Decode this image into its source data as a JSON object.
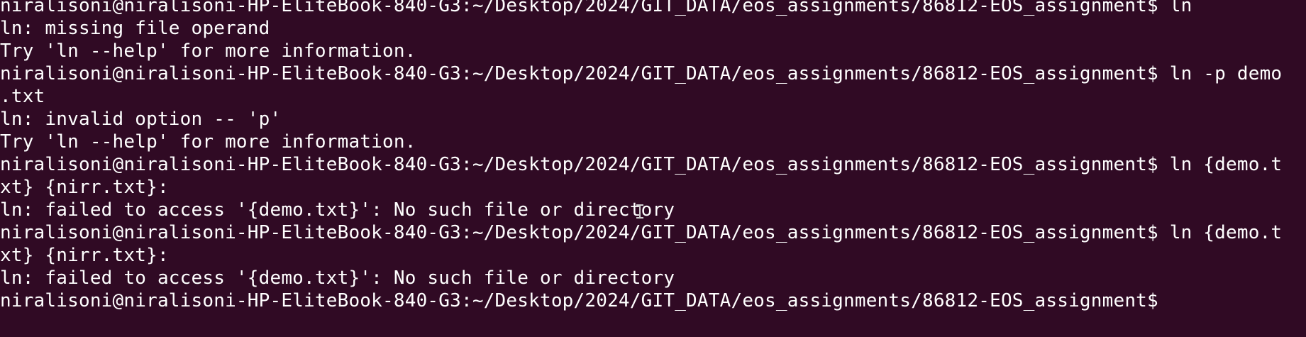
{
  "terminal": {
    "background": "#300a24",
    "foreground": "#ffffff",
    "lines": [
      "niralisoni@niralisoni-HP-EliteBook-840-G3:~/Desktop/2024/GIT_DATA/eos_assignments/86812-EOS_assignment$ ln",
      "ln: missing file operand",
      "Try 'ln --help' for more information.",
      "niralisoni@niralisoni-HP-EliteBook-840-G3:~/Desktop/2024/GIT_DATA/eos_assignments/86812-EOS_assignment$ ln -p demo",
      ".txt",
      "ln: invalid option -- 'p'",
      "Try 'ln --help' for more information.",
      "niralisoni@niralisoni-HP-EliteBook-840-G3:~/Desktop/2024/GIT_DATA/eos_assignments/86812-EOS_assignment$ ln {demo.t",
      "xt} {nirr.txt}:",
      "ln: failed to access '{demo.txt}': No such file or directory",
      "niralisoni@niralisoni-HP-EliteBook-840-G3:~/Desktop/2024/GIT_DATA/eos_assignments/86812-EOS_assignment$ ln {demo.t",
      "xt} {nirr.txt}:",
      "ln: failed to access '{demo.txt}': No such file or directory",
      "niralisoni@niralisoni-HP-EliteBook-840-G3:~/Desktop/2024/GIT_DATA/eos_assignments/86812-EOS_assignment$"
    ],
    "cursor_icon": "text-ibeam-cursor-icon"
  }
}
